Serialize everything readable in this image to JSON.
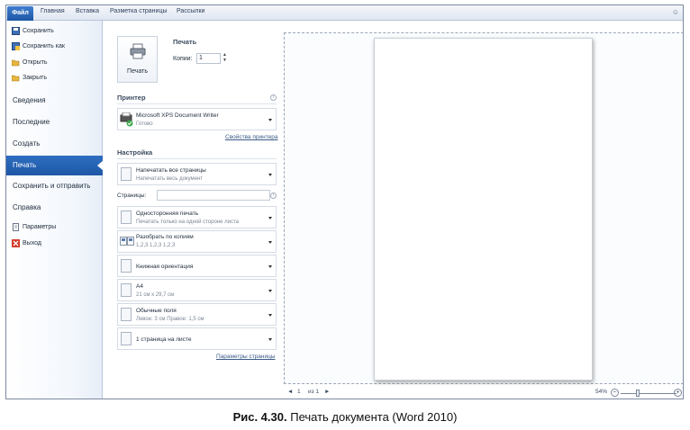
{
  "ribbon": {
    "file_tab": "Файл",
    "tabs": [
      "Главная",
      "Вставка",
      "Разметка страницы",
      "Рассылки"
    ],
    "help_icon": "help-icon"
  },
  "nav": {
    "commands": [
      {
        "label": "Сохранить",
        "icon": "save-icon"
      },
      {
        "label": "Сохранить как",
        "icon": "save-as-icon"
      },
      {
        "label": "Открыть",
        "icon": "open-folder-icon"
      },
      {
        "label": "Закрыть",
        "icon": "close-folder-icon"
      }
    ],
    "sections": [
      "Сведения",
      "Последние",
      "Создать",
      "Печать",
      "Сохранить и отправить",
      "Справка"
    ],
    "active_section": "Печать",
    "bottom_commands": [
      {
        "label": "Параметры",
        "icon": "options-icon"
      },
      {
        "label": "Выход",
        "icon": "exit-icon"
      }
    ]
  },
  "print": {
    "title": "Печать",
    "print_button": "Печать",
    "copies_label": "Копии:",
    "copies_value": "1",
    "printer_header": "Принтер",
    "printer_name": "Microsoft XPS Document Writer",
    "printer_status": "Готово",
    "printer_properties": "Свойства принтера",
    "settings_header": "Настройка",
    "pages_label": "Страницы:",
    "pages_value": "",
    "options": [
      {
        "l1": "Напечатать все страницы",
        "l2": "Напечатать весь документ",
        "icon": "pages-icon"
      },
      {
        "l1": "Односторонняя печать",
        "l2": "Печатать только на одной стороне листа",
        "icon": "one-sided-icon"
      },
      {
        "l1": "Разобрать по копиям",
        "l2": "1,2,3    1,2,3    1,2,3",
        "icon": "collate-icon"
      },
      {
        "l1": "Книжная ориентация",
        "l2": "",
        "icon": "portrait-icon"
      },
      {
        "l1": "A4",
        "l2": "21 см x 29,7 см",
        "icon": "paper-size-icon"
      },
      {
        "l1": "Обычные поля",
        "l2": "Левое: 3 см    Правое: 1,5 см",
        "icon": "margins-icon"
      },
      {
        "l1": "1 страница на листе",
        "l2": "",
        "icon": "pages-per-sheet-icon"
      }
    ],
    "page_setup_link": "Параметры страницы"
  },
  "status": {
    "page_current": "1",
    "page_total": "из 1",
    "zoom": "54%",
    "zoom_level": 0.54
  },
  "caption": {
    "figure": "Рис. 4.30.",
    "text": "Печать документа (Word 2010)"
  }
}
